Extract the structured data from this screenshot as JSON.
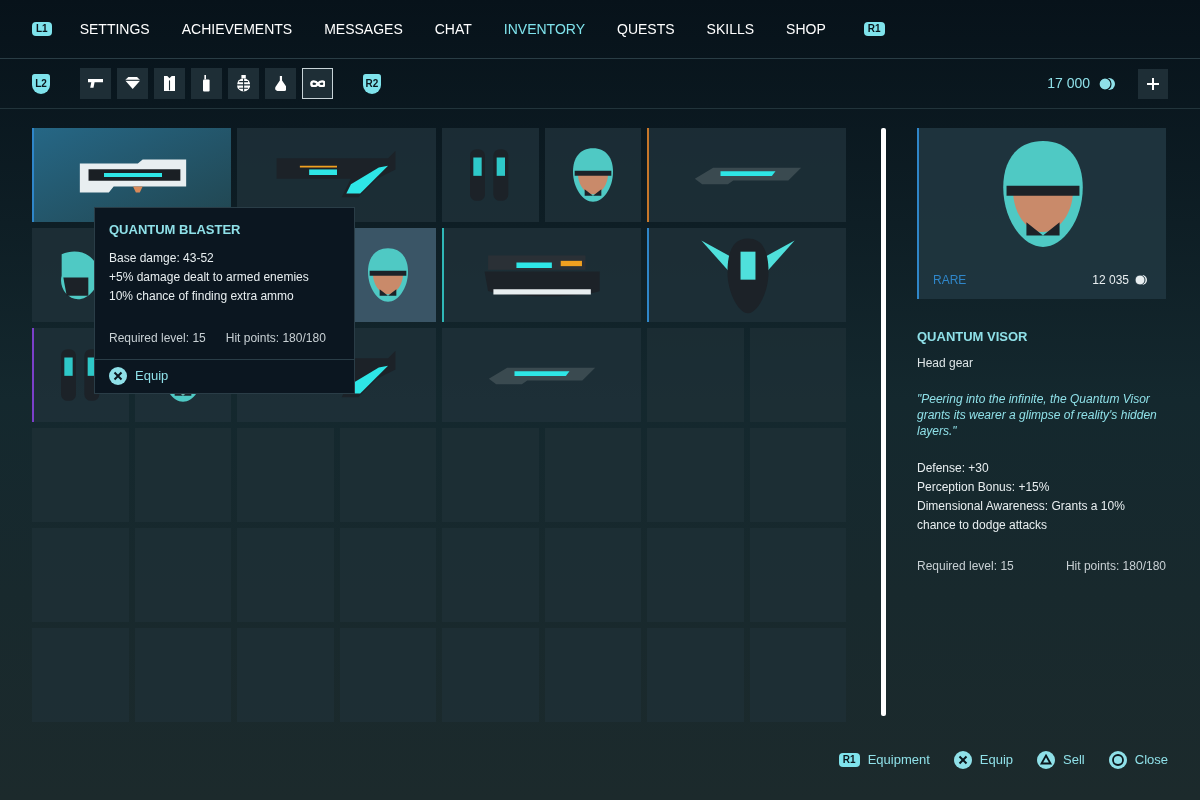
{
  "nav": {
    "left_badge": "L1",
    "right_badge": "R1",
    "tabs": [
      {
        "label": "SETTINGS",
        "selected": false
      },
      {
        "label": "ACHIEVEMENTS",
        "selected": false
      },
      {
        "label": "MESSAGES",
        "selected": false
      },
      {
        "label": "CHAT",
        "selected": false
      },
      {
        "label": "INVENTORY",
        "selected": true
      },
      {
        "label": "QUESTS",
        "selected": false
      },
      {
        "label": "SKILLS",
        "selected": false
      },
      {
        "label": "SHOP",
        "selected": false
      }
    ]
  },
  "filters": {
    "left_badge": "L2",
    "right_badge": "R2",
    "categories": [
      {
        "kind": "pistol",
        "selected": false
      },
      {
        "kind": "diamond",
        "selected": false
      },
      {
        "kind": "vest",
        "selected": false
      },
      {
        "kind": "radio",
        "selected": false
      },
      {
        "kind": "grenade",
        "selected": false
      },
      {
        "kind": "flask",
        "selected": false
      },
      {
        "kind": "infinity",
        "selected": true
      }
    ]
  },
  "currency": {
    "amount": "17 000"
  },
  "inventory": [
    {
      "kind": "blaster",
      "color": "#2f86c9",
      "selected": false,
      "hovered": true
    },
    {
      "kind": "rifle",
      "selected": false,
      "hovered": false
    },
    {
      "kind": "canisters",
      "selected": false,
      "hovered": false
    },
    {
      "kind": "helmet",
      "selected": false,
      "hovered": false
    },
    {
      "kind": "blade",
      "color": "#c7772a",
      "selected": false,
      "hovered": false
    },
    {
      "kind": "helmet-side",
      "selected": false,
      "hovered": false
    },
    {
      "kind": "empty"
    },
    {
      "kind": "empty"
    },
    {
      "kind": "helmet",
      "selected": true,
      "hovered": false
    },
    {
      "kind": "gun",
      "color": "#2fb7b7",
      "selected": false,
      "hovered": false
    },
    {
      "kind": "wings",
      "color": "#2f86c9",
      "selected": false,
      "hovered": false
    },
    {
      "kind": "canisters",
      "color": "#7b3fc9",
      "selected": false,
      "hovered": false
    },
    {
      "kind": "helmet",
      "selected": false,
      "hovered": false
    },
    {
      "kind": "rifle",
      "selected": false,
      "hovered": false
    },
    {
      "kind": "blade",
      "selected": false,
      "hovered": false
    }
  ],
  "tooltip": {
    "title": "QUANTUM BLASTER",
    "stats": [
      "Base damge: 43-52",
      "+5% damage dealt to armed enemies",
      "10% chance of finding extra ammo"
    ],
    "required_level": "Required level: 15",
    "hit_points": "Hit points: 180/180",
    "action": "Equip"
  },
  "details": {
    "rarity": "RARE",
    "price": "12 035",
    "name": "QUANTUM VISOR",
    "type": "Head gear",
    "quote": "\"Peering into the infinite, the Quantum Visor grants its wearer a glimpse of reality's hidden layers.\"",
    "stats": [
      "Defense: +30",
      "Perception Bonus: +15%",
      "Dimensional Awareness: Grants a 10% chance to dodge attacks"
    ],
    "required_level": "Required level: 15",
    "hit_points": "Hit points: 180/180"
  },
  "footer": [
    {
      "kind": "r1",
      "badge": "R1",
      "label": "Equipment"
    },
    {
      "kind": "cross",
      "label": "Equip"
    },
    {
      "kind": "triangle",
      "label": "Sell"
    },
    {
      "kind": "circle",
      "label": "Close"
    }
  ]
}
